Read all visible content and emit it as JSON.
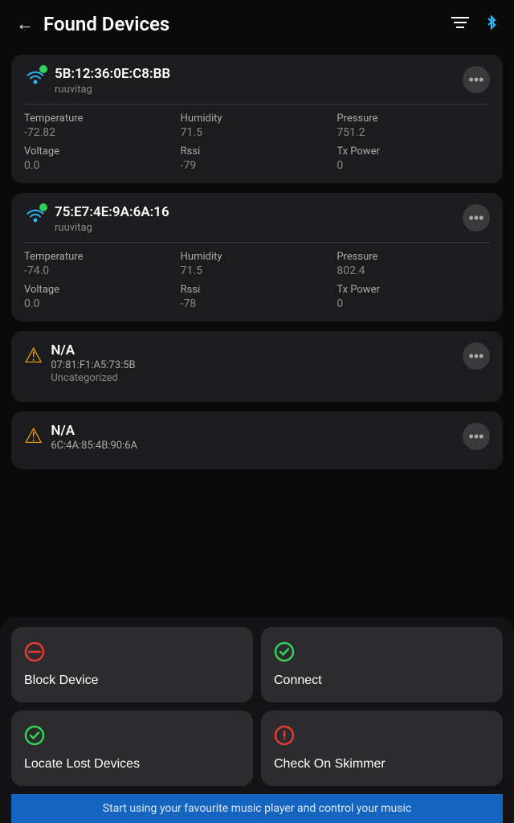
{
  "header": {
    "back_label": "←",
    "title": "Found Devices",
    "filter_icon": "≡",
    "bluetooth_icon": "✦"
  },
  "devices": [
    {
      "id": "device-1",
      "mac": "5B:12:36:0E:C8:BB",
      "type": "ruuvitag",
      "status": "connected",
      "temperature_label": "Temperature",
      "temperature_value": "-72.82",
      "humidity_label": "Humidity",
      "humidity_value": "71.5",
      "pressure_label": "Pressure",
      "pressure_value": "751.2",
      "voltage_label": "Voltage",
      "voltage_value": "0.0",
      "rssi_label": "Rssi",
      "rssi_value": "-79",
      "txpower_label": "Tx Power",
      "txpower_value": "0"
    },
    {
      "id": "device-2",
      "mac": "75:E7:4E:9A:6A:16",
      "type": "ruuvitag",
      "status": "connected",
      "temperature_label": "Temperature",
      "temperature_value": "-74.0",
      "humidity_label": "Humidity",
      "humidity_value": "71.5",
      "pressure_label": "Pressure",
      "pressure_value": "802.4",
      "voltage_label": "Voltage",
      "voltage_value": "0.0",
      "rssi_label": "Rssi",
      "rssi_value": "-78",
      "txpower_label": "Tx Power",
      "txpower_value": "0"
    },
    {
      "id": "device-3",
      "mac": "07:81:F1:A5:73:5B",
      "name": "N/A",
      "category": "Uncategorized",
      "status": "warning"
    },
    {
      "id": "device-4",
      "mac": "6C:4A:85:4B:90:6A",
      "name": "N/A",
      "status": "warning"
    }
  ],
  "actions": [
    {
      "id": "block-device",
      "label": "Block Device",
      "icon": "block",
      "icon_type": "block"
    },
    {
      "id": "connect",
      "label": "Connect",
      "icon": "link",
      "icon_type": "connect"
    },
    {
      "id": "locate-lost",
      "label": "Locate Lost Devices",
      "icon": "check-circle",
      "icon_type": "locate"
    },
    {
      "id": "check-skimmer",
      "label": "Check On Skimmer",
      "icon": "alert",
      "icon_type": "skimmer"
    }
  ],
  "media_bar": {
    "text": "Start using your favourite music player and control your music"
  }
}
